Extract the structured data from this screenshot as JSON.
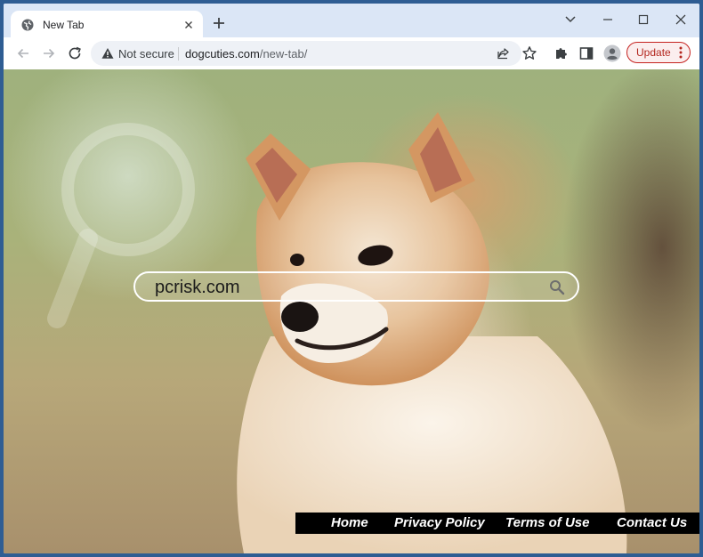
{
  "browser": {
    "tab": {
      "title": "New Tab"
    },
    "address_bar": {
      "security_label": "Not secure",
      "host": "dogcuties.com",
      "path": "/new-tab/"
    },
    "update_button": {
      "label": "Update"
    }
  },
  "page": {
    "search": {
      "value": "pcrisk.com"
    },
    "footer": {
      "links": [
        "Home",
        "Privacy Policy",
        "Terms of Use",
        "Contact Us"
      ]
    }
  }
}
